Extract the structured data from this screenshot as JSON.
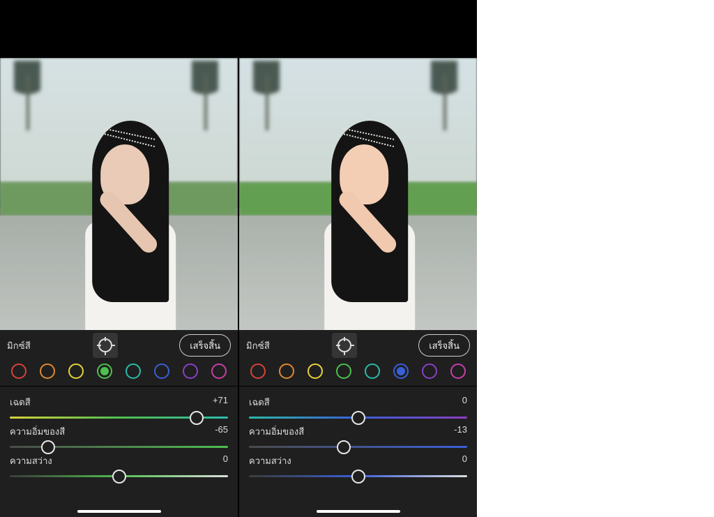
{
  "panel_title": "มิกซ์สี",
  "target_tool_label": "target-adjust",
  "done_label": "เสร็จสิ้น",
  "swatch_colors": [
    {
      "name": "red",
      "hex": "#d8423a"
    },
    {
      "name": "orange",
      "hex": "#e08a2e"
    },
    {
      "name": "yellow",
      "hex": "#e7d23b"
    },
    {
      "name": "green",
      "hex": "#4fbf4f"
    },
    {
      "name": "aqua",
      "hex": "#2db9a9"
    },
    {
      "name": "blue",
      "hex": "#3a5fd8"
    },
    {
      "name": "purple",
      "hex": "#8a3fc5"
    },
    {
      "name": "magenta",
      "hex": "#c53fa8"
    }
  ],
  "panels": [
    {
      "selected_swatch_index": 3,
      "hue": {
        "label": "เฉดสี",
        "value": "+71",
        "pos": 85.5,
        "track": {
          "start": "#d8d23b",
          "mid": "#4fbf4f",
          "end": "#2db9a9"
        }
      },
      "saturation": {
        "label": "ความอิ่มของสี",
        "value": "-65",
        "pos": 17.5,
        "track": {
          "sat": "#4fbf4f"
        }
      },
      "luminance": {
        "label": "ความสว่าง",
        "value": "0",
        "pos": 50,
        "track": {
          "lum": "#4fbf4f"
        }
      }
    },
    {
      "selected_swatch_index": 5,
      "hue": {
        "label": "เฉดสี",
        "value": "0",
        "pos": 50,
        "track": {
          "start": "#2db9a9",
          "mid": "#3a5fd8",
          "end": "#8a3fc5"
        }
      },
      "saturation": {
        "label": "ความอิ่มของสี",
        "value": "-13",
        "pos": 43.5,
        "track": {
          "sat": "#3a5fd8"
        }
      },
      "luminance": {
        "label": "ความสว่าง",
        "value": "0",
        "pos": 50,
        "track": {
          "lum": "#3a5fd8"
        }
      }
    }
  ]
}
